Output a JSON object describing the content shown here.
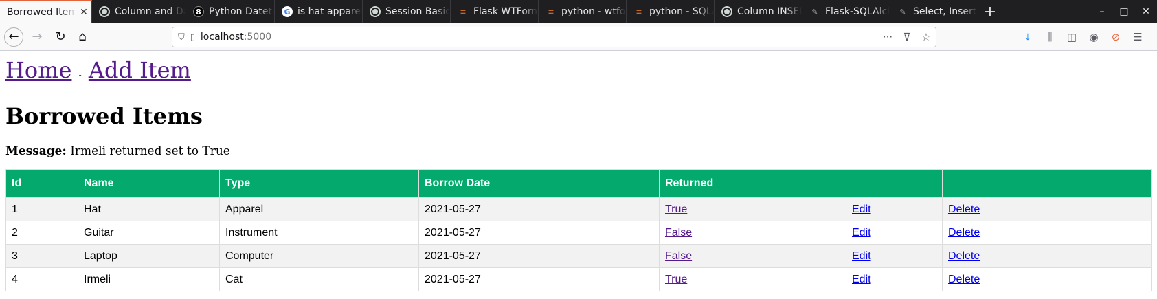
{
  "browser": {
    "tabs": [
      {
        "label": "Borrowed Items",
        "favicon": "none",
        "active": true
      },
      {
        "label": "Column and Data",
        "favicon": "site-icon"
      },
      {
        "label": "Python Datetime",
        "favicon": "dark-icon"
      },
      {
        "label": "is hat apparel",
        "favicon": "google-icon"
      },
      {
        "label": "Session Basics",
        "favicon": "site-icon"
      },
      {
        "label": "Flask WTForms",
        "favicon": "stackoverflow-icon"
      },
      {
        "label": "python - wtforms",
        "favicon": "stackoverflow-icon"
      },
      {
        "label": "python - SQLA",
        "favicon": "stackoverflow-icon"
      },
      {
        "label": "Column INSERT",
        "favicon": "site-icon"
      },
      {
        "label": "Flask-SQLAlchemy",
        "favicon": "flask-icon"
      },
      {
        "label": "Select, Insert,",
        "favicon": "flask-icon"
      }
    ],
    "url": {
      "host": "localhost",
      "port": ":5000"
    }
  },
  "nav": {
    "home": "Home",
    "separator": "-",
    "add_item": "Add Item"
  },
  "heading": "Borrowed Items",
  "message": {
    "label": "Message:",
    "text": "Irmeli returned set to True"
  },
  "table": {
    "headers": [
      "Id",
      "Name",
      "Type",
      "Borrow Date",
      "Returned",
      "",
      ""
    ],
    "rows": [
      {
        "id": "1",
        "name": "Hat",
        "type": "Apparel",
        "date": "2021-05-27",
        "returned": "True",
        "edit": "Edit",
        "delete": "Delete"
      },
      {
        "id": "2",
        "name": "Guitar",
        "type": "Instrument",
        "date": "2021-05-27",
        "returned": "False",
        "edit": "Edit",
        "delete": "Delete"
      },
      {
        "id": "3",
        "name": "Laptop",
        "type": "Computer",
        "date": "2021-05-27",
        "returned": "False",
        "edit": "Edit",
        "delete": "Delete"
      },
      {
        "id": "4",
        "name": "Irmeli",
        "type": "Cat",
        "date": "2021-05-27",
        "returned": "True",
        "edit": "Edit",
        "delete": "Delete"
      }
    ]
  },
  "colors": {
    "header_green": "#04aa6d",
    "visited_link": "#551a8b",
    "link": "#0000ee",
    "active_tab_accent": "#e5633a"
  }
}
